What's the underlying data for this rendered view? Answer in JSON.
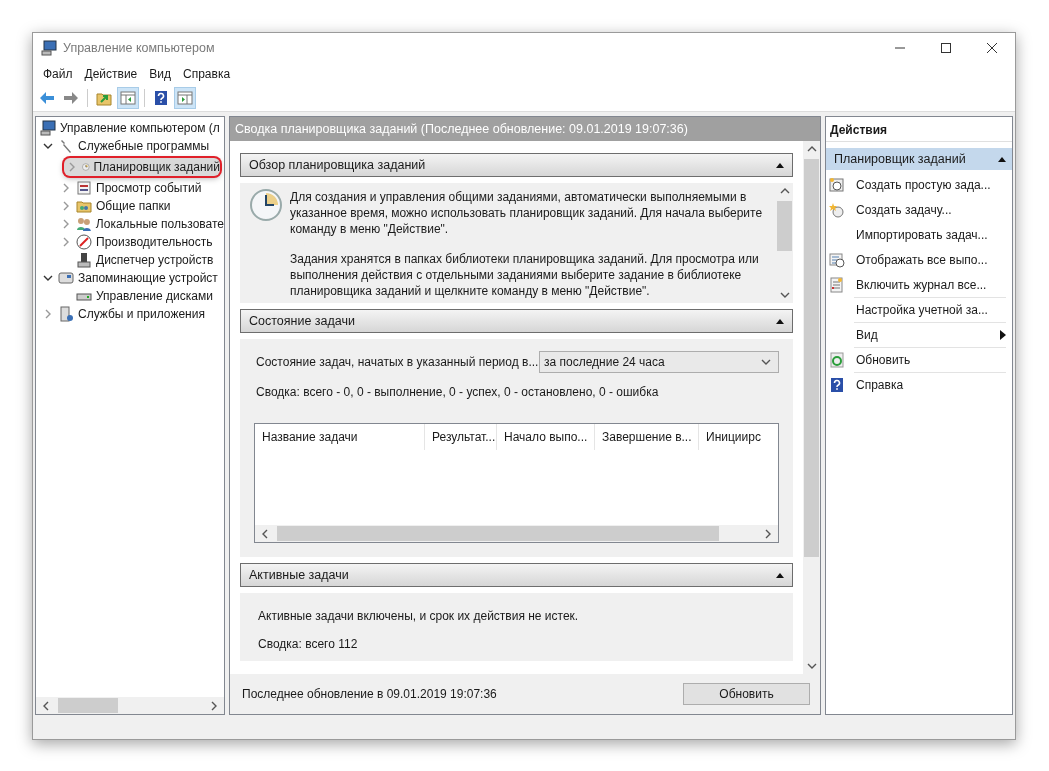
{
  "window": {
    "title": "Управление компьютером"
  },
  "menu": [
    "Файл",
    "Действие",
    "Вид",
    "Справка"
  ],
  "toolbar": [
    {
      "kind": "back",
      "pressed": false
    },
    {
      "kind": "forward",
      "pressed": false
    },
    {
      "kind": "separator"
    },
    {
      "kind": "up",
      "pressed": false
    },
    {
      "kind": "tree-toggle",
      "pressed": true
    },
    {
      "kind": "separator"
    },
    {
      "kind": "help",
      "pressed": false
    },
    {
      "kind": "pane-toggle",
      "pressed": true
    }
  ],
  "tree": [
    {
      "label": "Управление компьютером (л",
      "kind": "computer",
      "selected": false,
      "children": [
        {
          "label": "Служебные программы",
          "kind": "tools",
          "expanded": true,
          "selected": false,
          "children": [
            {
              "label": "Планировщик заданий",
              "kind": "clock",
              "expanded": false,
              "selected": true
            },
            {
              "label": "Просмотр событий",
              "kind": "events",
              "expanded": false,
              "selected": false
            },
            {
              "label": "Общие папки",
              "kind": "folder",
              "expanded": false,
              "selected": false
            },
            {
              "label": "Локальные пользовате",
              "kind": "users",
              "expanded": false,
              "selected": false
            },
            {
              "label": "Производительность",
              "kind": "gauge",
              "expanded": false,
              "selected": false
            },
            {
              "label": "Диспетчер устройств",
              "kind": "device",
              "selected": false
            }
          ]
        },
        {
          "label": "Запоминающие устройст",
          "kind": "storage",
          "expanded": true,
          "selected": false,
          "children": [
            {
              "label": "Управление дисками",
              "kind": "disk",
              "selected": false
            }
          ]
        },
        {
          "label": "Службы и приложения",
          "kind": "services",
          "expanded": false,
          "selected": false
        }
      ]
    }
  ],
  "center": {
    "header": "Сводка планировщика заданий (Последнее обновление: 09.01.2019 19:07:36)",
    "overview": {
      "title": "Обзор планировщика заданий",
      "expanded": true,
      "paragraphs": [
        "Для создания и управления общими заданиями, автоматически выполняемыми в указанное время, можно использовать планировщик заданий. Для начала выберите команду в меню \"Действие\".",
        "Задания хранятся в папках библиотеки планировщика заданий. Для просмотра или выполнения действия с отдельными заданиями выберите задание в библиотеке планировщика заданий и щелкните команду в меню \"Действие\"."
      ]
    },
    "status": {
      "title": "Состояние задачи",
      "expanded": true,
      "label": "Состояние задач, начатых в указанный период в...",
      "period": "за последние 24 часа",
      "summary": "Сводка: всего - 0, 0 - выполнение, 0 - успех, 0 - остановлено, 0 - ошибка",
      "table": {
        "columns": [
          "Название задачи",
          "Результат...",
          "Начало выпо...",
          "Завершение в...",
          "Инициирс"
        ]
      }
    },
    "active": {
      "title": "Активные задачи",
      "expanded": true,
      "text": "Активные задачи включены, и срок их действия не истек.",
      "summary": "Сводка: всего 112"
    },
    "footer": {
      "text": "Последнее обновление в 09.01.2019 19:07:36",
      "button": "Обновить"
    }
  },
  "actions": {
    "title": "Действия",
    "group": {
      "title": "Планировщик заданий",
      "expanded": true
    },
    "items": [
      {
        "label": "Создать простую зада...",
        "kind": "calendar-clock",
        "divider_above": false
      },
      {
        "label": "Создать задачу...",
        "kind": "clock-star",
        "divider_above": false
      },
      {
        "label": "Импортировать задач...",
        "divider_above": false
      },
      {
        "label": "Отображать все выпо...",
        "kind": "list-clock",
        "divider_above": false
      },
      {
        "label": "Включить журнал все...",
        "kind": "log",
        "divider_above": false
      },
      {
        "label": "Настройка учетной за...",
        "divider_above": true
      },
      {
        "label": "Вид",
        "submenu": true,
        "divider_above": true
      },
      {
        "label": "Обновить",
        "kind": "refresh",
        "divider_above": true
      },
      {
        "label": "Справка",
        "kind": "help",
        "divider_above": true
      }
    ]
  }
}
